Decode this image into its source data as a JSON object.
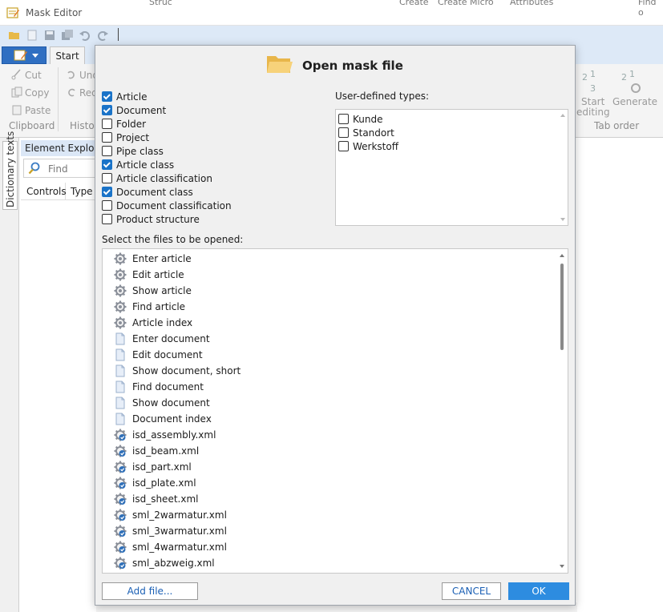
{
  "window": {
    "app_title": "Mask Editor",
    "bg_tab_1": "Struc",
    "bg_tab_2": "Create",
    "bg_tab_3": "Create Micro",
    "bg_tab_4": "Attributes",
    "bg_tab_5": "Find o"
  },
  "ribbon": {
    "tab_start": "Start",
    "cut": "Cut",
    "copy": "Copy",
    "paste": "Paste",
    "undo": "Und",
    "redo": "Red",
    "group_clipboard": "Clipboard",
    "group_history": "Histor",
    "start_editing_1": "Start",
    "start_editing_2": "editing",
    "generate": "Generate",
    "group_tab_order": "Tab order"
  },
  "side": {
    "dictionary_tab": "Dictionary texts"
  },
  "explorer": {
    "title": "Element Explorer",
    "find_placeholder": "Find",
    "col_controls": "Controls",
    "col_type": "Type"
  },
  "dialog": {
    "title": "Open mask file",
    "types": [
      {
        "label": "Article",
        "checked": true
      },
      {
        "label": "Document",
        "checked": true
      },
      {
        "label": "Folder",
        "checked": false
      },
      {
        "label": "Project",
        "checked": false
      },
      {
        "label": "Pipe class",
        "checked": false
      },
      {
        "label": "Article class",
        "checked": true
      },
      {
        "label": "Article classification",
        "checked": false
      },
      {
        "label": "Document class",
        "checked": true
      },
      {
        "label": "Document classification",
        "checked": false
      },
      {
        "label": "Product structure",
        "checked": false
      }
    ],
    "user_defined_label": "User-defined types:",
    "user_defined_types": [
      {
        "label": "Kunde",
        "checked": false
      },
      {
        "label": "Standort",
        "checked": false
      },
      {
        "label": "Werkstoff",
        "checked": false
      }
    ],
    "files_label": "Select the files to be opened:",
    "files": [
      {
        "label": "Enter article",
        "icon": "gear-icon"
      },
      {
        "label": "Edit article",
        "icon": "gear-icon"
      },
      {
        "label": "Show article",
        "icon": "gear-icon"
      },
      {
        "label": "Find article",
        "icon": "gear-icon"
      },
      {
        "label": "Article index",
        "icon": "gear-icon"
      },
      {
        "label": "Enter document",
        "icon": "document-icon"
      },
      {
        "label": "Edit document",
        "icon": "document-icon"
      },
      {
        "label": "Show document, short",
        "icon": "document-icon"
      },
      {
        "label": "Find document",
        "icon": "document-icon"
      },
      {
        "label": "Show document",
        "icon": "document-icon"
      },
      {
        "label": "Document index",
        "icon": "document-icon"
      },
      {
        "label": "isd_assembly.xml",
        "icon": "xml-gear-icon"
      },
      {
        "label": "isd_beam.xml",
        "icon": "xml-gear-icon"
      },
      {
        "label": "isd_part.xml",
        "icon": "xml-gear-icon"
      },
      {
        "label": "isd_plate.xml",
        "icon": "xml-gear-icon"
      },
      {
        "label": "isd_sheet.xml",
        "icon": "xml-gear-icon"
      },
      {
        "label": "sml_2warmatur.xml",
        "icon": "xml-gear-icon"
      },
      {
        "label": "sml_3warmatur.xml",
        "icon": "xml-gear-icon"
      },
      {
        "label": "sml_4warmatur.xml",
        "icon": "xml-gear-icon"
      },
      {
        "label": "sml_abzweig.xml",
        "icon": "xml-gear-icon"
      }
    ],
    "add_file": "Add file...",
    "cancel": "CANCEL",
    "ok": "OK"
  },
  "colors": {
    "accent": "#2d8ce0",
    "checkbox_checked": "#1a73c8",
    "ribbon_bg": "#dde9f7",
    "dialog_bg": "#f0f0f0"
  }
}
